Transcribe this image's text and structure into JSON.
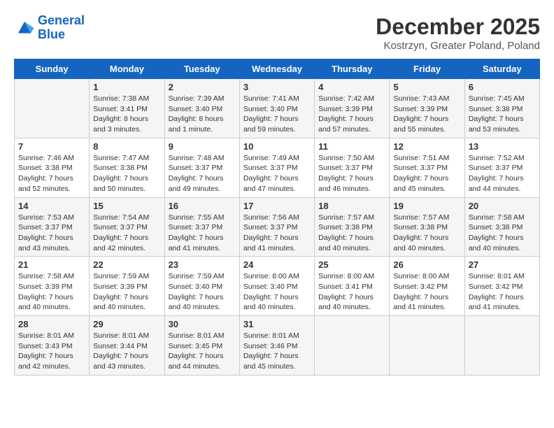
{
  "logo": {
    "line1": "General",
    "line2": "Blue"
  },
  "title": "December 2025",
  "location": "Kostrzyn, Greater Poland, Poland",
  "days_of_week": [
    "Sunday",
    "Monday",
    "Tuesday",
    "Wednesday",
    "Thursday",
    "Friday",
    "Saturday"
  ],
  "weeks": [
    [
      {
        "day": "",
        "content": ""
      },
      {
        "day": "1",
        "content": "Sunrise: 7:38 AM\nSunset: 3:41 PM\nDaylight: 8 hours\nand 3 minutes."
      },
      {
        "day": "2",
        "content": "Sunrise: 7:39 AM\nSunset: 3:40 PM\nDaylight: 8 hours\nand 1 minute."
      },
      {
        "day": "3",
        "content": "Sunrise: 7:41 AM\nSunset: 3:40 PM\nDaylight: 7 hours\nand 59 minutes."
      },
      {
        "day": "4",
        "content": "Sunrise: 7:42 AM\nSunset: 3:39 PM\nDaylight: 7 hours\nand 57 minutes."
      },
      {
        "day": "5",
        "content": "Sunrise: 7:43 AM\nSunset: 3:39 PM\nDaylight: 7 hours\nand 55 minutes."
      },
      {
        "day": "6",
        "content": "Sunrise: 7:45 AM\nSunset: 3:38 PM\nDaylight: 7 hours\nand 53 minutes."
      }
    ],
    [
      {
        "day": "7",
        "content": "Sunrise: 7:46 AM\nSunset: 3:38 PM\nDaylight: 7 hours\nand 52 minutes."
      },
      {
        "day": "8",
        "content": "Sunrise: 7:47 AM\nSunset: 3:38 PM\nDaylight: 7 hours\nand 50 minutes."
      },
      {
        "day": "9",
        "content": "Sunrise: 7:48 AM\nSunset: 3:37 PM\nDaylight: 7 hours\nand 49 minutes."
      },
      {
        "day": "10",
        "content": "Sunrise: 7:49 AM\nSunset: 3:37 PM\nDaylight: 7 hours\nand 47 minutes."
      },
      {
        "day": "11",
        "content": "Sunrise: 7:50 AM\nSunset: 3:37 PM\nDaylight: 7 hours\nand 46 minutes."
      },
      {
        "day": "12",
        "content": "Sunrise: 7:51 AM\nSunset: 3:37 PM\nDaylight: 7 hours\nand 45 minutes."
      },
      {
        "day": "13",
        "content": "Sunrise: 7:52 AM\nSunset: 3:37 PM\nDaylight: 7 hours\nand 44 minutes."
      }
    ],
    [
      {
        "day": "14",
        "content": "Sunrise: 7:53 AM\nSunset: 3:37 PM\nDaylight: 7 hours\nand 43 minutes."
      },
      {
        "day": "15",
        "content": "Sunrise: 7:54 AM\nSunset: 3:37 PM\nDaylight: 7 hours\nand 42 minutes."
      },
      {
        "day": "16",
        "content": "Sunrise: 7:55 AM\nSunset: 3:37 PM\nDaylight: 7 hours\nand 41 minutes."
      },
      {
        "day": "17",
        "content": "Sunrise: 7:56 AM\nSunset: 3:37 PM\nDaylight: 7 hours\nand 41 minutes."
      },
      {
        "day": "18",
        "content": "Sunrise: 7:57 AM\nSunset: 3:38 PM\nDaylight: 7 hours\nand 40 minutes."
      },
      {
        "day": "19",
        "content": "Sunrise: 7:57 AM\nSunset: 3:38 PM\nDaylight: 7 hours\nand 40 minutes."
      },
      {
        "day": "20",
        "content": "Sunrise: 7:58 AM\nSunset: 3:38 PM\nDaylight: 7 hours\nand 40 minutes."
      }
    ],
    [
      {
        "day": "21",
        "content": "Sunrise: 7:58 AM\nSunset: 3:39 PM\nDaylight: 7 hours\nand 40 minutes."
      },
      {
        "day": "22",
        "content": "Sunrise: 7:59 AM\nSunset: 3:39 PM\nDaylight: 7 hours\nand 40 minutes."
      },
      {
        "day": "23",
        "content": "Sunrise: 7:59 AM\nSunset: 3:40 PM\nDaylight: 7 hours\nand 40 minutes."
      },
      {
        "day": "24",
        "content": "Sunrise: 8:00 AM\nSunset: 3:40 PM\nDaylight: 7 hours\nand 40 minutes."
      },
      {
        "day": "25",
        "content": "Sunrise: 8:00 AM\nSunset: 3:41 PM\nDaylight: 7 hours\nand 40 minutes."
      },
      {
        "day": "26",
        "content": "Sunrise: 8:00 AM\nSunset: 3:42 PM\nDaylight: 7 hours\nand 41 minutes."
      },
      {
        "day": "27",
        "content": "Sunrise: 8:01 AM\nSunset: 3:42 PM\nDaylight: 7 hours\nand 41 minutes."
      }
    ],
    [
      {
        "day": "28",
        "content": "Sunrise: 8:01 AM\nSunset: 3:43 PM\nDaylight: 7 hours\nand 42 minutes."
      },
      {
        "day": "29",
        "content": "Sunrise: 8:01 AM\nSunset: 3:44 PM\nDaylight: 7 hours\nand 43 minutes."
      },
      {
        "day": "30",
        "content": "Sunrise: 8:01 AM\nSunset: 3:45 PM\nDaylight: 7 hours\nand 44 minutes."
      },
      {
        "day": "31",
        "content": "Sunrise: 8:01 AM\nSunset: 3:46 PM\nDaylight: 7 hours\nand 45 minutes."
      },
      {
        "day": "",
        "content": ""
      },
      {
        "day": "",
        "content": ""
      },
      {
        "day": "",
        "content": ""
      }
    ]
  ]
}
